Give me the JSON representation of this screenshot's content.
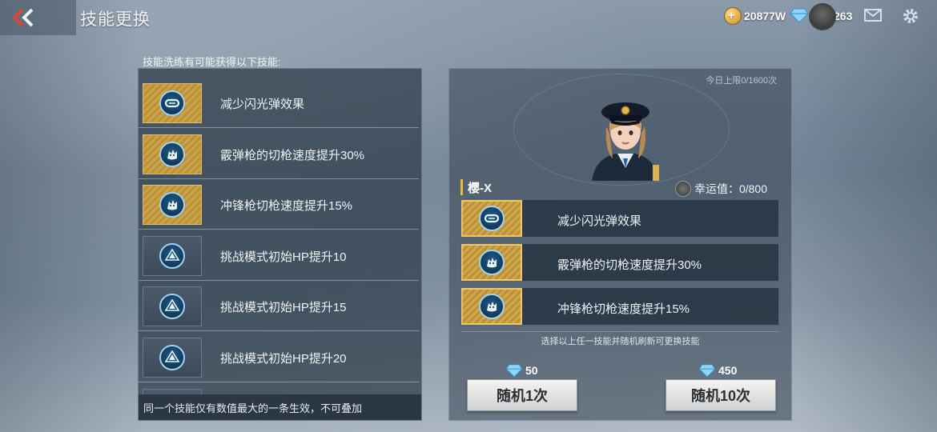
{
  "header": {
    "title": "技能更换",
    "gold_amount": "20877W",
    "diamond_amount": "263"
  },
  "skill_list": {
    "caption": "技能洗练有可能获得以下技能:",
    "items": [
      {
        "label": "减少闪光弹效果",
        "tier": "gold",
        "icon": "goggles-icon"
      },
      {
        "label": "霰弹枪的切枪速度提升30%",
        "tier": "gold",
        "icon": "wolf-icon"
      },
      {
        "label": "冲锋枪切枪速度提升15%",
        "tier": "gold",
        "icon": "wolf-icon"
      },
      {
        "label": "挑战模式初始HP提升10",
        "tier": "gray",
        "icon": "up-arrow-icon"
      },
      {
        "label": "挑战模式初始HP提升15",
        "tier": "gray",
        "icon": "up-arrow-icon"
      },
      {
        "label": "挑战模式初始HP提升20",
        "tier": "gray",
        "icon": "up-arrow-icon"
      }
    ],
    "footer": "同一个技能仅有数值最大的一条生效，不可叠加"
  },
  "character_panel": {
    "daily_limit": "今日上限0/1600次",
    "character_name": "樱-X",
    "luck_label": "幸运值：0/800",
    "current_skills": [
      {
        "label": "减少闪光弹效果",
        "icon": "goggles-icon"
      },
      {
        "label": "霰弹枪的切枪速度提升30%",
        "icon": "wolf-icon"
      },
      {
        "label": "冲锋枪切枪速度提升15%",
        "icon": "wolf-icon"
      }
    ],
    "hint": "选择以上任一技能并随机刷新可更换技能",
    "roll_once": {
      "cost": "50",
      "label": "随机1次"
    },
    "roll_ten": {
      "cost": "450",
      "label": "随机10次"
    }
  },
  "colors": {
    "accent_gold": "#e8b93a",
    "skill_ring": "#9fd3f2",
    "back_arrow": "#e0453a"
  }
}
